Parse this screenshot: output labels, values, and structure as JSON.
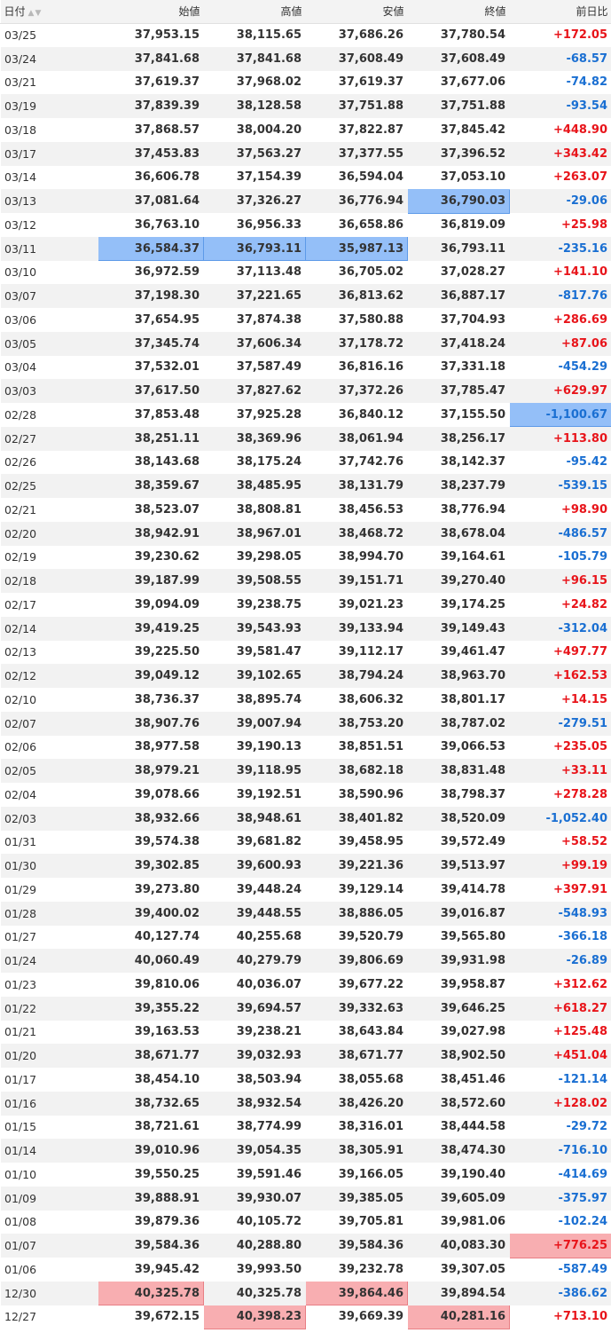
{
  "headers": {
    "date": "日付",
    "open": "始値",
    "high": "高値",
    "low": "安値",
    "close": "終値",
    "change": "前日比"
  },
  "icons": {
    "sort_asc": "sort-up-icon",
    "sort_desc": "sort-down-icon"
  },
  "colors": {
    "up": "#e8141a",
    "down": "#1a6fd2",
    "highlight_min": "#94bff8",
    "highlight_max": "#f8aeb1"
  },
  "rows": [
    {
      "date": "03/25",
      "open": "37,953.15",
      "high": "38,115.65",
      "low": "37,686.26",
      "close": "37,780.54",
      "change": "+172.05",
      "dir": "up",
      "hl": []
    },
    {
      "date": "03/24",
      "open": "37,841.68",
      "high": "37,841.68",
      "low": "37,608.49",
      "close": "37,608.49",
      "change": "-68.57",
      "dir": "down",
      "hl": []
    },
    {
      "date": "03/21",
      "open": "37,619.37",
      "high": "37,968.02",
      "low": "37,619.37",
      "close": "37,677.06",
      "change": "-74.82",
      "dir": "down",
      "hl": []
    },
    {
      "date": "03/19",
      "open": "37,839.39",
      "high": "38,128.58",
      "low": "37,751.88",
      "close": "37,751.88",
      "change": "-93.54",
      "dir": "down",
      "hl": []
    },
    {
      "date": "03/18",
      "open": "37,868.57",
      "high": "38,004.20",
      "low": "37,822.87",
      "close": "37,845.42",
      "change": "+448.90",
      "dir": "up",
      "hl": []
    },
    {
      "date": "03/17",
      "open": "37,453.83",
      "high": "37,563.27",
      "low": "37,377.55",
      "close": "37,396.52",
      "change": "+343.42",
      "dir": "up",
      "hl": []
    },
    {
      "date": "03/14",
      "open": "36,606.78",
      "high": "37,154.39",
      "low": "36,594.04",
      "close": "37,053.10",
      "change": "+263.07",
      "dir": "up",
      "hl": []
    },
    {
      "date": "03/13",
      "open": "37,081.64",
      "high": "37,326.27",
      "low": "36,776.94",
      "close": "36,790.03",
      "change": "-29.06",
      "dir": "down",
      "hl": [
        [
          "close",
          "blue"
        ]
      ]
    },
    {
      "date": "03/12",
      "open": "36,763.10",
      "high": "36,956.33",
      "low": "36,658.86",
      "close": "36,819.09",
      "change": "+25.98",
      "dir": "up",
      "hl": []
    },
    {
      "date": "03/11",
      "open": "36,584.37",
      "high": "36,793.11",
      "low": "35,987.13",
      "close": "36,793.11",
      "change": "-235.16",
      "dir": "down",
      "hl": [
        [
          "open",
          "blue"
        ],
        [
          "high",
          "blue"
        ],
        [
          "low",
          "blue"
        ]
      ]
    },
    {
      "date": "03/10",
      "open": "36,972.59",
      "high": "37,113.48",
      "low": "36,705.02",
      "close": "37,028.27",
      "change": "+141.10",
      "dir": "up",
      "hl": []
    },
    {
      "date": "03/07",
      "open": "37,198.30",
      "high": "37,221.65",
      "low": "36,813.62",
      "close": "36,887.17",
      "change": "-817.76",
      "dir": "down",
      "hl": []
    },
    {
      "date": "03/06",
      "open": "37,654.95",
      "high": "37,874.38",
      "low": "37,580.88",
      "close": "37,704.93",
      "change": "+286.69",
      "dir": "up",
      "hl": []
    },
    {
      "date": "03/05",
      "open": "37,345.74",
      "high": "37,606.34",
      "low": "37,178.72",
      "close": "37,418.24",
      "change": "+87.06",
      "dir": "up",
      "hl": []
    },
    {
      "date": "03/04",
      "open": "37,532.01",
      "high": "37,587.49",
      "low": "36,816.16",
      "close": "37,331.18",
      "change": "-454.29",
      "dir": "down",
      "hl": []
    },
    {
      "date": "03/03",
      "open": "37,617.50",
      "high": "37,827.62",
      "low": "37,372.26",
      "close": "37,785.47",
      "change": "+629.97",
      "dir": "up",
      "hl": []
    },
    {
      "date": "02/28",
      "open": "37,853.48",
      "high": "37,925.28",
      "low": "36,840.12",
      "close": "37,155.50",
      "change": "-1,100.67",
      "dir": "down",
      "hl": [
        [
          "change",
          "blue"
        ]
      ]
    },
    {
      "date": "02/27",
      "open": "38,251.11",
      "high": "38,369.96",
      "low": "38,061.94",
      "close": "38,256.17",
      "change": "+113.80",
      "dir": "up",
      "hl": []
    },
    {
      "date": "02/26",
      "open": "38,143.68",
      "high": "38,175.24",
      "low": "37,742.76",
      "close": "38,142.37",
      "change": "-95.42",
      "dir": "down",
      "hl": []
    },
    {
      "date": "02/25",
      "open": "38,359.67",
      "high": "38,485.95",
      "low": "38,131.79",
      "close": "38,237.79",
      "change": "-539.15",
      "dir": "down",
      "hl": []
    },
    {
      "date": "02/21",
      "open": "38,523.07",
      "high": "38,808.81",
      "low": "38,456.53",
      "close": "38,776.94",
      "change": "+98.90",
      "dir": "up",
      "hl": []
    },
    {
      "date": "02/20",
      "open": "38,942.91",
      "high": "38,967.01",
      "low": "38,468.72",
      "close": "38,678.04",
      "change": "-486.57",
      "dir": "down",
      "hl": []
    },
    {
      "date": "02/19",
      "open": "39,230.62",
      "high": "39,298.05",
      "low": "38,994.70",
      "close": "39,164.61",
      "change": "-105.79",
      "dir": "down",
      "hl": []
    },
    {
      "date": "02/18",
      "open": "39,187.99",
      "high": "39,508.55",
      "low": "39,151.71",
      "close": "39,270.40",
      "change": "+96.15",
      "dir": "up",
      "hl": []
    },
    {
      "date": "02/17",
      "open": "39,094.09",
      "high": "39,238.75",
      "low": "39,021.23",
      "close": "39,174.25",
      "change": "+24.82",
      "dir": "up",
      "hl": []
    },
    {
      "date": "02/14",
      "open": "39,419.25",
      "high": "39,543.93",
      "low": "39,133.94",
      "close": "39,149.43",
      "change": "-312.04",
      "dir": "down",
      "hl": []
    },
    {
      "date": "02/13",
      "open": "39,225.50",
      "high": "39,581.47",
      "low": "39,112.17",
      "close": "39,461.47",
      "change": "+497.77",
      "dir": "up",
      "hl": []
    },
    {
      "date": "02/12",
      "open": "39,049.12",
      "high": "39,102.65",
      "low": "38,794.24",
      "close": "38,963.70",
      "change": "+162.53",
      "dir": "up",
      "hl": []
    },
    {
      "date": "02/10",
      "open": "38,736.37",
      "high": "38,895.74",
      "low": "38,606.32",
      "close": "38,801.17",
      "change": "+14.15",
      "dir": "up",
      "hl": []
    },
    {
      "date": "02/07",
      "open": "38,907.76",
      "high": "39,007.94",
      "low": "38,753.20",
      "close": "38,787.02",
      "change": "-279.51",
      "dir": "down",
      "hl": []
    },
    {
      "date": "02/06",
      "open": "38,977.58",
      "high": "39,190.13",
      "low": "38,851.51",
      "close": "39,066.53",
      "change": "+235.05",
      "dir": "up",
      "hl": []
    },
    {
      "date": "02/05",
      "open": "38,979.21",
      "high": "39,118.95",
      "low": "38,682.18",
      "close": "38,831.48",
      "change": "+33.11",
      "dir": "up",
      "hl": []
    },
    {
      "date": "02/04",
      "open": "39,078.66",
      "high": "39,192.51",
      "low": "38,590.96",
      "close": "38,798.37",
      "change": "+278.28",
      "dir": "up",
      "hl": []
    },
    {
      "date": "02/03",
      "open": "38,932.66",
      "high": "38,948.61",
      "low": "38,401.82",
      "close": "38,520.09",
      "change": "-1,052.40",
      "dir": "down",
      "hl": []
    },
    {
      "date": "01/31",
      "open": "39,574.38",
      "high": "39,681.82",
      "low": "39,458.95",
      "close": "39,572.49",
      "change": "+58.52",
      "dir": "up",
      "hl": []
    },
    {
      "date": "01/30",
      "open": "39,302.85",
      "high": "39,600.93",
      "low": "39,221.36",
      "close": "39,513.97",
      "change": "+99.19",
      "dir": "up",
      "hl": []
    },
    {
      "date": "01/29",
      "open": "39,273.80",
      "high": "39,448.24",
      "low": "39,129.14",
      "close": "39,414.78",
      "change": "+397.91",
      "dir": "up",
      "hl": []
    },
    {
      "date": "01/28",
      "open": "39,400.02",
      "high": "39,448.55",
      "low": "38,886.05",
      "close": "39,016.87",
      "change": "-548.93",
      "dir": "down",
      "hl": []
    },
    {
      "date": "01/27",
      "open": "40,127.74",
      "high": "40,255.68",
      "low": "39,520.79",
      "close": "39,565.80",
      "change": "-366.18",
      "dir": "down",
      "hl": []
    },
    {
      "date": "01/24",
      "open": "40,060.49",
      "high": "40,279.79",
      "low": "39,806.69",
      "close": "39,931.98",
      "change": "-26.89",
      "dir": "down",
      "hl": []
    },
    {
      "date": "01/23",
      "open": "39,810.06",
      "high": "40,036.07",
      "low": "39,677.22",
      "close": "39,958.87",
      "change": "+312.62",
      "dir": "up",
      "hl": []
    },
    {
      "date": "01/22",
      "open": "39,355.22",
      "high": "39,694.57",
      "low": "39,332.63",
      "close": "39,646.25",
      "change": "+618.27",
      "dir": "up",
      "hl": []
    },
    {
      "date": "01/21",
      "open": "39,163.53",
      "high": "39,238.21",
      "low": "38,643.84",
      "close": "39,027.98",
      "change": "+125.48",
      "dir": "up",
      "hl": []
    },
    {
      "date": "01/20",
      "open": "38,671.77",
      "high": "39,032.93",
      "low": "38,671.77",
      "close": "38,902.50",
      "change": "+451.04",
      "dir": "up",
      "hl": []
    },
    {
      "date": "01/17",
      "open": "38,454.10",
      "high": "38,503.94",
      "low": "38,055.68",
      "close": "38,451.46",
      "change": "-121.14",
      "dir": "down",
      "hl": []
    },
    {
      "date": "01/16",
      "open": "38,732.65",
      "high": "38,932.54",
      "low": "38,426.20",
      "close": "38,572.60",
      "change": "+128.02",
      "dir": "up",
      "hl": []
    },
    {
      "date": "01/15",
      "open": "38,721.61",
      "high": "38,774.99",
      "low": "38,316.01",
      "close": "38,444.58",
      "change": "-29.72",
      "dir": "down",
      "hl": []
    },
    {
      "date": "01/14",
      "open": "39,010.96",
      "high": "39,054.35",
      "low": "38,305.91",
      "close": "38,474.30",
      "change": "-716.10",
      "dir": "down",
      "hl": []
    },
    {
      "date": "01/10",
      "open": "39,550.25",
      "high": "39,591.46",
      "low": "39,166.05",
      "close": "39,190.40",
      "change": "-414.69",
      "dir": "down",
      "hl": []
    },
    {
      "date": "01/09",
      "open": "39,888.91",
      "high": "39,930.07",
      "low": "39,385.05",
      "close": "39,605.09",
      "change": "-375.97",
      "dir": "down",
      "hl": []
    },
    {
      "date": "01/08",
      "open": "39,879.36",
      "high": "40,105.72",
      "low": "39,705.81",
      "close": "39,981.06",
      "change": "-102.24",
      "dir": "down",
      "hl": []
    },
    {
      "date": "01/07",
      "open": "39,584.36",
      "high": "40,288.80",
      "low": "39,584.36",
      "close": "40,083.30",
      "change": "+776.25",
      "dir": "up",
      "hl": [
        [
          "change",
          "red"
        ]
      ]
    },
    {
      "date": "01/06",
      "open": "39,945.42",
      "high": "39,993.50",
      "low": "39,232.78",
      "close": "39,307.05",
      "change": "-587.49",
      "dir": "down",
      "hl": []
    },
    {
      "date": "12/30",
      "open": "40,325.78",
      "high": "40,325.78",
      "low": "39,864.46",
      "close": "39,894.54",
      "change": "-386.62",
      "dir": "down",
      "hl": [
        [
          "open",
          "red"
        ],
        [
          "low",
          "red"
        ]
      ]
    },
    {
      "date": "12/27",
      "open": "39,672.15",
      "high": "40,398.23",
      "low": "39,669.39",
      "close": "40,281.16",
      "change": "+713.10",
      "dir": "up",
      "hl": [
        [
          "high",
          "red"
        ],
        [
          "close",
          "red"
        ]
      ]
    }
  ]
}
